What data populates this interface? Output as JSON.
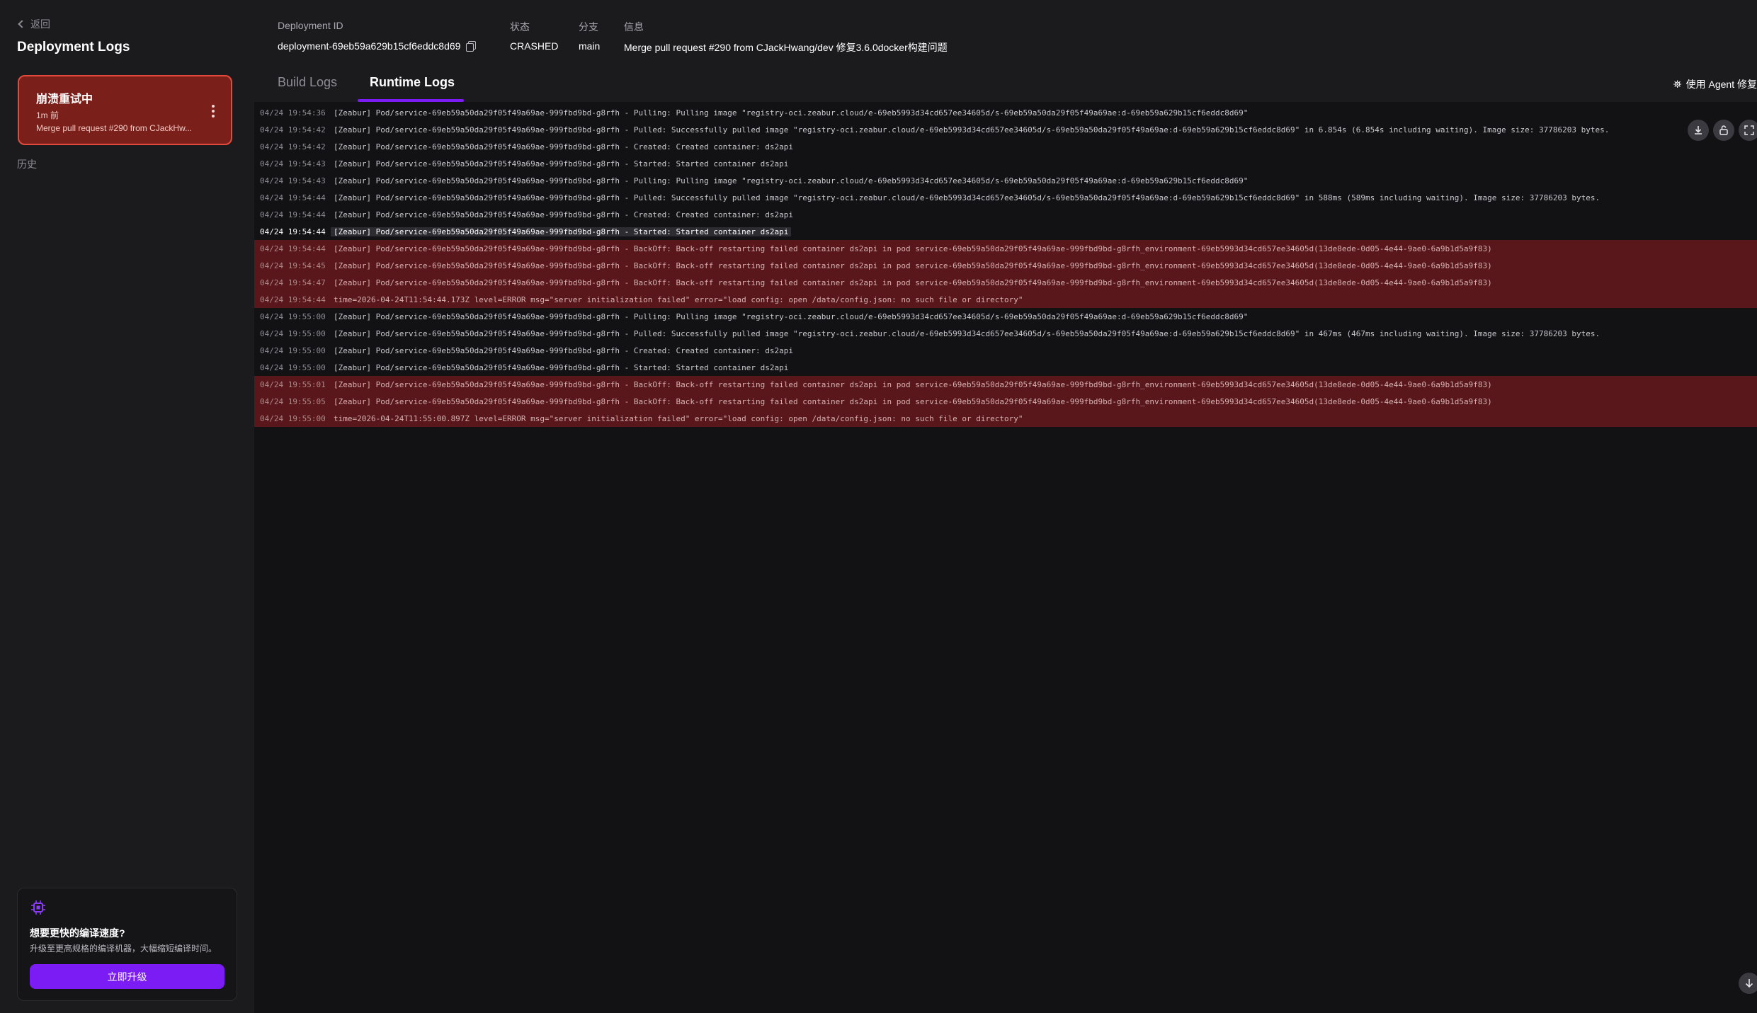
{
  "sidebar": {
    "back_label": "返回",
    "title": "Deployment Logs",
    "current_deployment": {
      "status": "崩溃重试中",
      "time": "1m 前",
      "message": "Merge pull request #290 from CJackHw..."
    },
    "history_label": "历史",
    "upgrade": {
      "icon": "chip-icon",
      "title": "想要更快的编译速度?",
      "description": "升级至更高规格的编译机器，大幅缩短编译时间。",
      "button_label": "立即升级",
      "accent": "#7b1cf5"
    }
  },
  "header": {
    "deployment_id_label": "Deployment ID",
    "deployment_id": "deployment-69eb59a629b15cf6eddc8d69",
    "status_label": "状态",
    "status": "CRASHED",
    "branch_label": "分支",
    "branch": "main",
    "info_label": "信息",
    "info": "Merge pull request #290 from CJackHwang/dev 修复3.6.0docker构建问题"
  },
  "tabs": {
    "build": "Build Logs",
    "runtime": "Runtime Logs",
    "active": "runtime",
    "agent_fix": "使用 Agent 修复"
  },
  "logs": [
    {
      "ts": "04/24 19:54:36",
      "msg": "[Zeabur] Pod/service-69eb59a50da29f05f49a69ae-999fbd9bd-g8rfh - Pulling: Pulling image \"registry-oci.zeabur.cloud/e-69eb5993d34cd657ee34605d/s-69eb59a50da29f05f49a69ae:d-69eb59a629b15cf6eddc8d69\"",
      "level": "info"
    },
    {
      "ts": "04/24 19:54:42",
      "msg": "[Zeabur] Pod/service-69eb59a50da29f05f49a69ae-999fbd9bd-g8rfh - Pulled: Successfully pulled image \"registry-oci.zeabur.cloud/e-69eb5993d34cd657ee34605d/s-69eb59a50da29f05f49a69ae:d-69eb59a629b15cf6eddc8d69\" in 6.854s (6.854s including waiting). Image size: 37786203 bytes.",
      "level": "info"
    },
    {
      "ts": "04/24 19:54:42",
      "msg": "[Zeabur] Pod/service-69eb59a50da29f05f49a69ae-999fbd9bd-g8rfh - Created: Created container: ds2api",
      "level": "info"
    },
    {
      "ts": "04/24 19:54:43",
      "msg": "[Zeabur] Pod/service-69eb59a50da29f05f49a69ae-999fbd9bd-g8rfh - Started: Started container ds2api",
      "level": "info"
    },
    {
      "ts": "04/24 19:54:43",
      "msg": "[Zeabur] Pod/service-69eb59a50da29f05f49a69ae-999fbd9bd-g8rfh - Pulling: Pulling image \"registry-oci.zeabur.cloud/e-69eb5993d34cd657ee34605d/s-69eb59a50da29f05f49a69ae:d-69eb59a629b15cf6eddc8d69\"",
      "level": "info"
    },
    {
      "ts": "04/24 19:54:44",
      "msg": "[Zeabur] Pod/service-69eb59a50da29f05f49a69ae-999fbd9bd-g8rfh - Pulled: Successfully pulled image \"registry-oci.zeabur.cloud/e-69eb5993d34cd657ee34605d/s-69eb59a50da29f05f49a69ae:d-69eb59a629b15cf6eddc8d69\" in 588ms (589ms including waiting). Image size: 37786203 bytes.",
      "level": "info"
    },
    {
      "ts": "04/24 19:54:44",
      "msg": "[Zeabur] Pod/service-69eb59a50da29f05f49a69ae-999fbd9bd-g8rfh - Created: Created container: ds2api",
      "level": "info"
    },
    {
      "ts": "04/24 19:54:44",
      "msg": "[Zeabur] Pod/service-69eb59a50da29f05f49a69ae-999fbd9bd-g8rfh - Started: Started container ds2api",
      "level": "highlight"
    },
    {
      "ts": "04/24 19:54:44",
      "msg": "[Zeabur] Pod/service-69eb59a50da29f05f49a69ae-999fbd9bd-g8rfh - BackOff: Back-off restarting failed container ds2api in pod service-69eb59a50da29f05f49a69ae-999fbd9bd-g8rfh_environment-69eb5993d34cd657ee34605d(13de8ede-0d05-4e44-9ae0-6a9b1d5a9f83)",
      "level": "error"
    },
    {
      "ts": "04/24 19:54:45",
      "msg": "[Zeabur] Pod/service-69eb59a50da29f05f49a69ae-999fbd9bd-g8rfh - BackOff: Back-off restarting failed container ds2api in pod service-69eb59a50da29f05f49a69ae-999fbd9bd-g8rfh_environment-69eb5993d34cd657ee34605d(13de8ede-0d05-4e44-9ae0-6a9b1d5a9f83)",
      "level": "error"
    },
    {
      "ts": "04/24 19:54:47",
      "msg": "[Zeabur] Pod/service-69eb59a50da29f05f49a69ae-999fbd9bd-g8rfh - BackOff: Back-off restarting failed container ds2api in pod service-69eb59a50da29f05f49a69ae-999fbd9bd-g8rfh_environment-69eb5993d34cd657ee34605d(13de8ede-0d05-4e44-9ae0-6a9b1d5a9f83)",
      "level": "error"
    },
    {
      "ts": "04/24 19:54:44",
      "msg": "time=2026-04-24T11:54:44.173Z level=ERROR msg=\"server initialization failed\" error=\"load config: open /data/config.json: no such file or directory\"",
      "level": "error"
    },
    {
      "ts": "04/24 19:55:00",
      "msg": "[Zeabur] Pod/service-69eb59a50da29f05f49a69ae-999fbd9bd-g8rfh - Pulling: Pulling image \"registry-oci.zeabur.cloud/e-69eb5993d34cd657ee34605d/s-69eb59a50da29f05f49a69ae:d-69eb59a629b15cf6eddc8d69\"",
      "level": "info"
    },
    {
      "ts": "04/24 19:55:00",
      "msg": "[Zeabur] Pod/service-69eb59a50da29f05f49a69ae-999fbd9bd-g8rfh - Pulled: Successfully pulled image \"registry-oci.zeabur.cloud/e-69eb5993d34cd657ee34605d/s-69eb59a50da29f05f49a69ae:d-69eb59a629b15cf6eddc8d69\" in 467ms (467ms including waiting). Image size: 37786203 bytes.",
      "level": "info"
    },
    {
      "ts": "04/24 19:55:00",
      "msg": "[Zeabur] Pod/service-69eb59a50da29f05f49a69ae-999fbd9bd-g8rfh - Created: Created container: ds2api",
      "level": "info"
    },
    {
      "ts": "04/24 19:55:00",
      "msg": "[Zeabur] Pod/service-69eb59a50da29f05f49a69ae-999fbd9bd-g8rfh - Started: Started container ds2api",
      "level": "info"
    },
    {
      "ts": "04/24 19:55:01",
      "msg": "[Zeabur] Pod/service-69eb59a50da29f05f49a69ae-999fbd9bd-g8rfh - BackOff: Back-off restarting failed container ds2api in pod service-69eb59a50da29f05f49a69ae-999fbd9bd-g8rfh_environment-69eb5993d34cd657ee34605d(13de8ede-0d05-4e44-9ae0-6a9b1d5a9f83)",
      "level": "error"
    },
    {
      "ts": "04/24 19:55:05",
      "msg": "[Zeabur] Pod/service-69eb59a50da29f05f49a69ae-999fbd9bd-g8rfh - BackOff: Back-off restarting failed container ds2api in pod service-69eb59a50da29f05f49a69ae-999fbd9bd-g8rfh_environment-69eb5993d34cd657ee34605d(13de8ede-0d05-4e44-9ae0-6a9b1d5a9f83)",
      "level": "error"
    },
    {
      "ts": "04/24 19:55:00",
      "msg": "time=2026-04-24T11:55:00.897Z level=ERROR msg=\"server initialization failed\" error=\"load config: open /data/config.json: no such file or directory\"",
      "level": "error"
    }
  ],
  "log_toolbar": {
    "download": "download-icon",
    "wrap": "unlock-icon",
    "fullscreen": "expand-icon",
    "scroll_bottom": "arrow-down-icon"
  },
  "colors": {
    "accent": "#7b1cf5",
    "crashed_card": "#7a1f1a",
    "crashed_border": "#e24b3b",
    "error_row": "#5a171b"
  }
}
